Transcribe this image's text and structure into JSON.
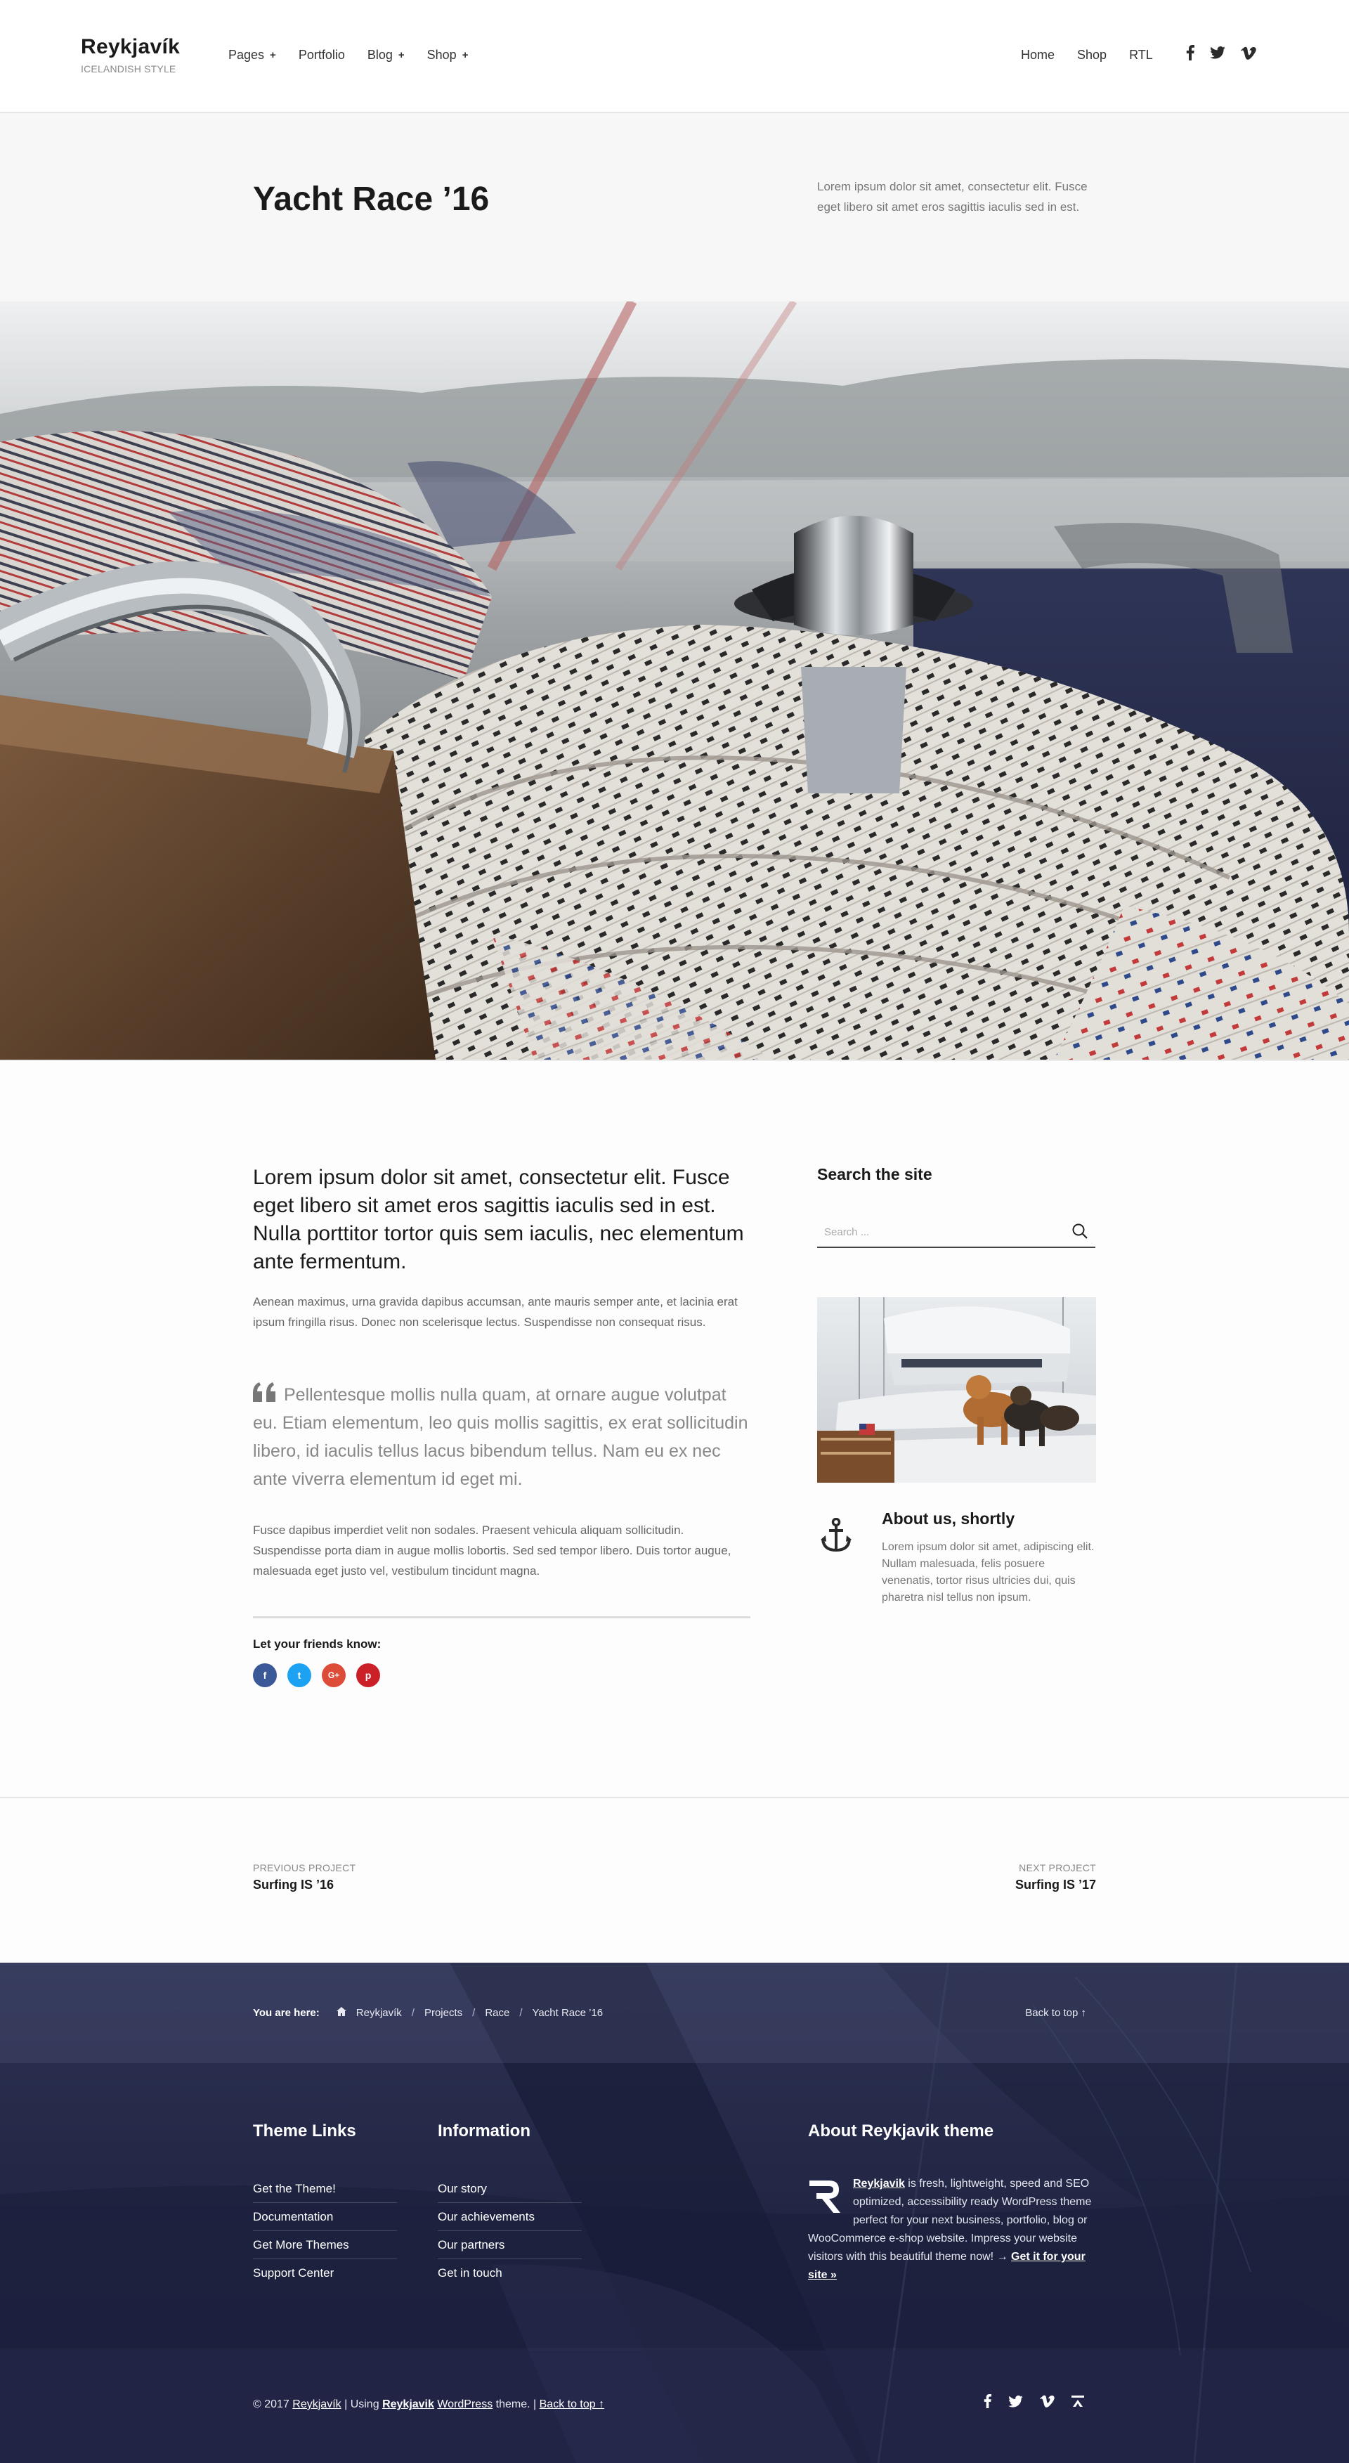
{
  "header": {
    "logo_name": "Reykjavík",
    "logo_tagline": "ICELANDISH STYLE",
    "nav_left": [
      {
        "label": "Pages",
        "has_submenu": true
      },
      {
        "label": "Portfolio",
        "has_submenu": false
      },
      {
        "label": "Blog",
        "has_submenu": true
      },
      {
        "label": "Shop",
        "has_submenu": true
      }
    ],
    "submenu_marker": "+",
    "nav_right": [
      "Home",
      "Shop",
      "RTL"
    ],
    "social_icons": [
      "facebook-icon",
      "twitter-icon",
      "vimeo-icon"
    ]
  },
  "title_band": {
    "title": "Yacht Race ’16",
    "description": "Lorem ipsum dolor sit amet, consectetur elit. Fusce eget libero sit amet eros sagittis iaculis sed in est."
  },
  "article": {
    "lead": "Lorem ipsum dolor sit amet, consectetur elit. Fusce eget libero sit amet eros sagittis iaculis sed in est. Nulla porttitor tortor quis sem iaculis, nec elementum ante fermentum.",
    "paragraph_1": "Aenean maximus, urna gravida dapibus accumsan, ante mauris semper ante, et lacinia erat ipsum fringilla risus. Donec non scelerisque lectus. Suspendisse non consequat risus.",
    "quote": "Pellentesque mollis nulla quam, at ornare augue volutpat eu. Etiam elementum, leo quis mollis sagittis, ex erat sollicitudin libero, id iaculis tellus lacus bibendum tellus. Nam eu ex nec ante viverra elementum id eget mi.",
    "paragraph_2": "Fusce dapibus imperdiet velit non sodales. Praesent vehicula aliquam sollicitudin. Suspendisse porta diam in augue mollis lobortis. Sed sed tempor libero. Duis tortor augue, malesuada eget justo vel, vestibulum tincidunt magna.",
    "share_label": "Let your friends know:",
    "share_buttons": [
      {
        "icon": "facebook-icon",
        "glyph": "f",
        "color": "#3b5998"
      },
      {
        "icon": "twitter-icon",
        "glyph": "t",
        "color": "#1da1f2"
      },
      {
        "icon": "google-plus-icon",
        "glyph": "G+",
        "color": "#dd4b39"
      },
      {
        "icon": "pinterest-icon",
        "glyph": "p",
        "color": "#cb2027"
      }
    ]
  },
  "sidebar": {
    "search_title": "Search the site",
    "search_placeholder": "Search ...",
    "about_title": "About us, shortly",
    "about_text": "Lorem ipsum dolor sit amet, adipiscing elit. Nullam malesuada, felis posuere venenatis, tortor risus ultricies dui, quis pharetra nisl tellus non ipsum.",
    "about_icon": "anchor-icon"
  },
  "project_nav": {
    "prev_label": "PREVIOUS PROJECT",
    "prev_name": "Surfing IS ’16",
    "next_label": "NEXT PROJECT",
    "next_name": "Surfing IS ’17"
  },
  "breadcrumb": {
    "label": "You are here:",
    "items": [
      "Reykjavík",
      "Projects",
      "Race",
      "Yacht Race ’16"
    ],
    "separator": "/",
    "back_to_top": "Back to top ↑"
  },
  "footer": {
    "col1_title": "Theme Links",
    "col1_links": [
      "Get the Theme!",
      "Documentation",
      "Get More Themes",
      "Support Center"
    ],
    "col2_title": "Information",
    "col2_links": [
      "Our story",
      "Our achievements",
      "Our partners",
      "Get in touch"
    ],
    "col3_title": "About Reykjavik theme",
    "about_brand": "Reykjavik",
    "about_text": "is fresh, lightweight, speed and SEO optimized, accessibility ready WordPress theme perfect for your next business, portfolio, blog or WooCommerce e-shop website. Impress your website visitors with this beautiful theme now! →",
    "about_link": "Get it for your site »",
    "copyright_prefix": "© 2017",
    "copyright_site": "Reykjavík",
    "copyright_using": "| Using",
    "copyright_theme": "Reykjavik",
    "copyright_wp": "WordPress",
    "copyright_suffix": "theme. |",
    "copyright_back": "Back to top ↑",
    "social_icons": [
      "facebook-icon",
      "twitter-icon",
      "vimeo-icon",
      "wpzoom-icon"
    ]
  },
  "colors": {
    "footer_bg": "#2a2e4a",
    "title_band_bg": "#f7f7f7",
    "text_dark": "#1a1a1a",
    "text_muted": "#777777"
  }
}
